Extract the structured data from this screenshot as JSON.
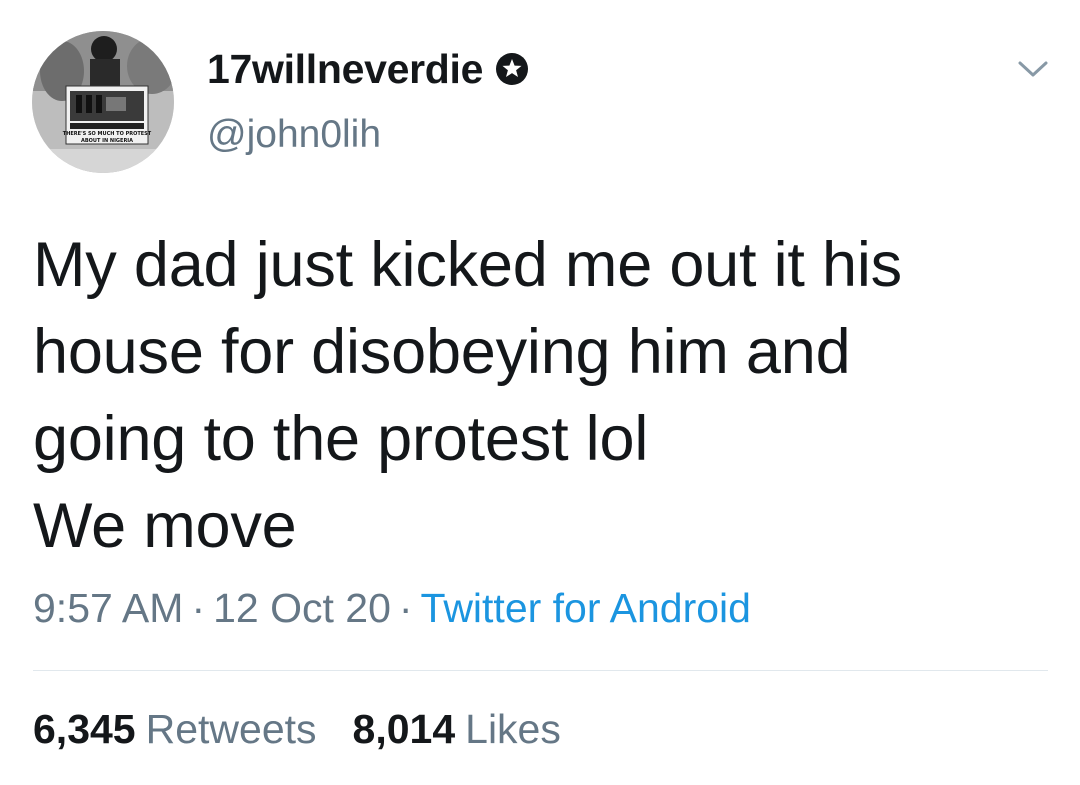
{
  "user": {
    "display_name": "17willneverdie",
    "handle": "@john0lih",
    "verified": true,
    "avatar_sign_text_1": "THERE'S SO MUCH TO PROTEST",
    "avatar_sign_text_2": "ABOUT IN NIGERIA"
  },
  "tweet": {
    "lines": [
      "My dad just kicked me out it his",
      "house for disobeying him and",
      "going to the protest lol",
      "We move"
    ],
    "time": "9:57 AM",
    "separator": "·",
    "date": "12 Oct 20",
    "source": "Twitter for Android"
  },
  "stats": {
    "retweets_count": "6,345",
    "retweets_label": "Retweets",
    "likes_count": "8,014",
    "likes_label": "Likes"
  },
  "colors": {
    "text": "#14171a",
    "secondary": "#657786",
    "link": "#1b95e0",
    "divider": "#e1e8ed"
  },
  "icons": {
    "verified": "verified-badge-icon",
    "menu": "chevron-down-icon"
  }
}
